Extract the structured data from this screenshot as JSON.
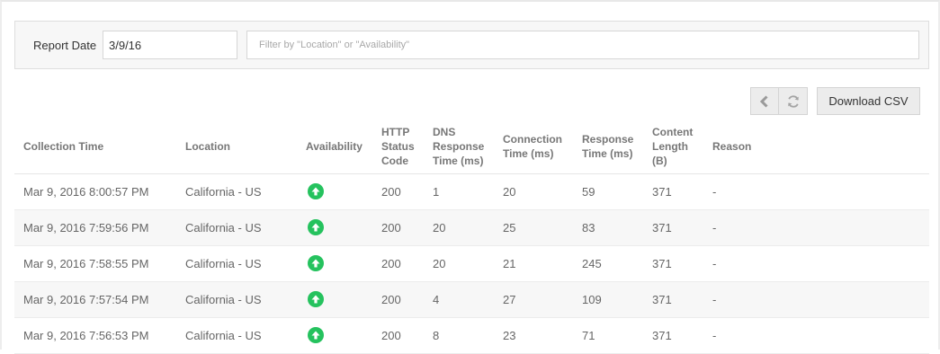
{
  "filter": {
    "report_date_label": "Report Date",
    "report_date_value": "3/9/16",
    "search_placeholder": "Filter by \"Location\" or \"Availability\""
  },
  "toolbar": {
    "prev_icon": "chevron-left-icon",
    "refresh_icon": "refresh-icon",
    "download_label": "Download CSV"
  },
  "table": {
    "headers": [
      [
        "Collection Time"
      ],
      [
        "Location"
      ],
      [
        "Availability"
      ],
      [
        "HTTP",
        "Status",
        "Code"
      ],
      [
        "DNS",
        "Response",
        "Time (ms)"
      ],
      [
        "Connection",
        "Time (ms)"
      ],
      [
        "Response",
        "Time (ms)"
      ],
      [
        "Content",
        "Length",
        "(B)"
      ],
      [
        "Reason"
      ]
    ],
    "availability_icon": "up-arrow-icon",
    "availability_color": "#25c25e",
    "rows": [
      {
        "time": "Mar 9, 2016 8:00:57 PM",
        "location": "California - US",
        "availability": "up",
        "status": "200",
        "dns": "1",
        "connection": "20",
        "response": "59",
        "length": "371",
        "reason": "-"
      },
      {
        "time": "Mar 9, 2016 7:59:56 PM",
        "location": "California - US",
        "availability": "up",
        "status": "200",
        "dns": "20",
        "connection": "25",
        "response": "83",
        "length": "371",
        "reason": "-"
      },
      {
        "time": "Mar 9, 2016 7:58:55 PM",
        "location": "California - US",
        "availability": "up",
        "status": "200",
        "dns": "20",
        "connection": "21",
        "response": "245",
        "length": "371",
        "reason": "-"
      },
      {
        "time": "Mar 9, 2016 7:57:54 PM",
        "location": "California - US",
        "availability": "up",
        "status": "200",
        "dns": "4",
        "connection": "27",
        "response": "109",
        "length": "371",
        "reason": "-"
      },
      {
        "time": "Mar 9, 2016 7:56:53 PM",
        "location": "California - US",
        "availability": "up",
        "status": "200",
        "dns": "8",
        "connection": "23",
        "response": "71",
        "length": "371",
        "reason": "-"
      }
    ]
  }
}
